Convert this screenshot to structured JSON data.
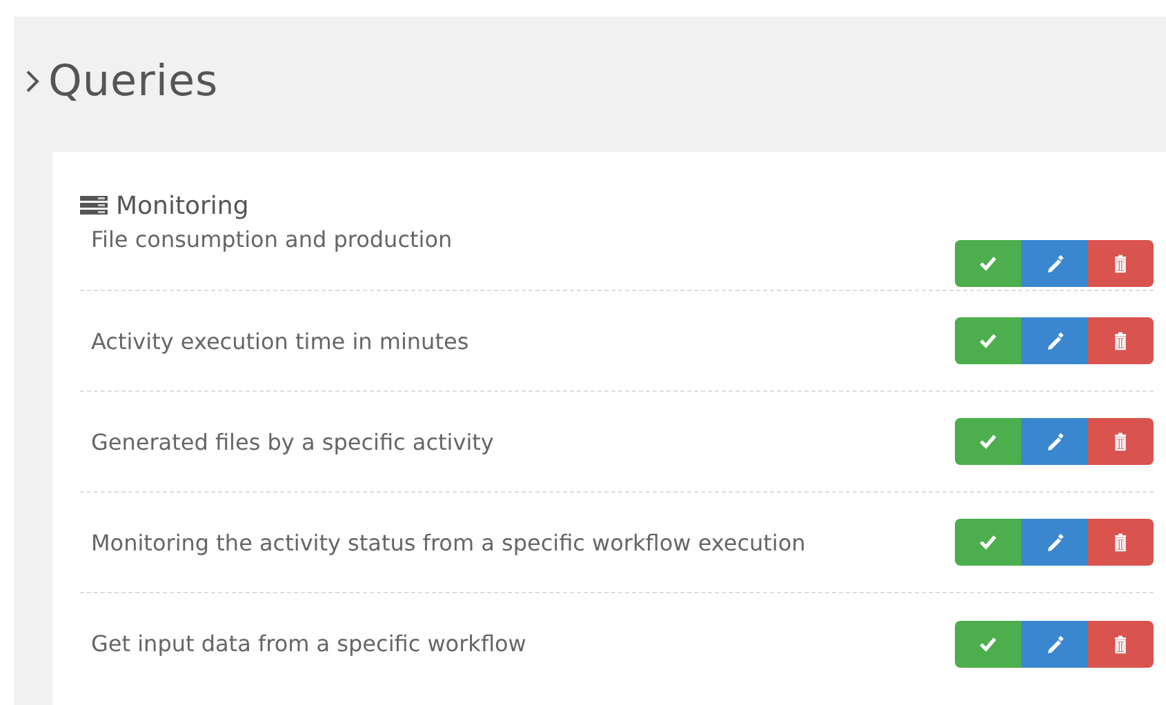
{
  "page": {
    "title": "Queries"
  },
  "section": {
    "title": "Monitoring"
  },
  "queries": [
    {
      "label": "File consumption and production"
    },
    {
      "label": "Activity execution time in minutes"
    },
    {
      "label": "Generated files by a specific activity"
    },
    {
      "label": "Monitoring the activity status from a specific workflow execution"
    },
    {
      "label": "Get input data from a specific workflow"
    }
  ]
}
